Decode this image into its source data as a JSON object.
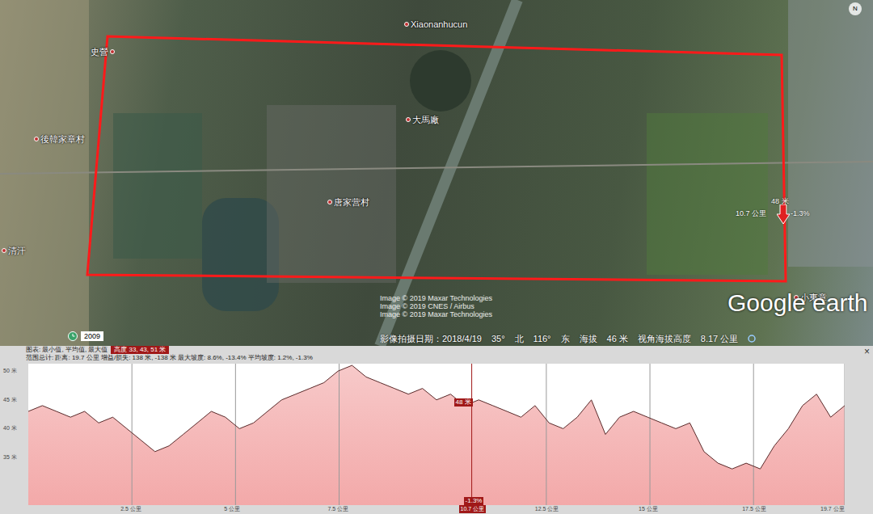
{
  "map": {
    "labels": [
      {
        "text": "史營"
      },
      {
        "text": "Xiaonanhucun"
      },
      {
        "text": "大馬廠"
      },
      {
        "text": "後韓家章村"
      },
      {
        "text": "唐家营村"
      },
      {
        "text": "清汗"
      },
      {
        "text": "小東章"
      }
    ],
    "attribution": [
      "Image © 2019 Maxar Technologies",
      "Image © 2019 CNES / Airbus",
      "Image © 2019 Maxar Technologies"
    ],
    "history_year": "2009",
    "logo": "Google earth",
    "compass": "N",
    "status": {
      "date_label": "影像拍摄日期：",
      "date": "2018/4/19",
      "lat": "35°",
      "lat_dir": "北",
      "lon": "116°",
      "lon_dir": "东",
      "elev_label": "海拔",
      "elev": "46 米",
      "eye_label": "视角海拔高度",
      "eye": "8.17 公里"
    },
    "marker": {
      "elevation": "48 米",
      "distance": "10.7 公里",
      "slope": "-1.3%"
    }
  },
  "profile": {
    "header": {
      "chart_label": "图表: 最小值, 平均值, 最大值",
      "highlight": "高度 33, 43, 51 米",
      "totals": "范围总计: 距离: 19.7 公里 增益/损失: 138 米, -138 米 最大坡度: 8.6%, -13.4% 平均坡度: 1.2%, -1.3%"
    },
    "close": "×",
    "distance_km": 19.7,
    "y_ticks": [
      {
        "label": "35 米",
        "value": 35
      },
      {
        "label": "40 米",
        "value": 40
      },
      {
        "label": "45 米",
        "value": 45
      },
      {
        "label": "50 米",
        "value": 50
      }
    ],
    "x_ticks": [
      {
        "label": "2.5 公里",
        "km": 2.5
      },
      {
        "label": "5 公里",
        "km": 5
      },
      {
        "label": "7.5 公里",
        "km": 7.5
      },
      {
        "label": "12.5 公里",
        "km": 12.5
      },
      {
        "label": "15 公里",
        "km": 15
      },
      {
        "label": "17.5 公里",
        "km": 17.5
      },
      {
        "label": "19.7 公里",
        "km": 19.7
      }
    ],
    "cursor": {
      "km": 10.7,
      "elevation": "48 米",
      "distance": "10.7 公里",
      "slope": "-1.3%"
    },
    "series": {
      "values": [
        43,
        44,
        43,
        42,
        43,
        41,
        42,
        40,
        38,
        36,
        37,
        39,
        41,
        43,
        42,
        40,
        41,
        43,
        45,
        46,
        47,
        48,
        50,
        51,
        49,
        48,
        47,
        46,
        47,
        45,
        46,
        44,
        45,
        44,
        43,
        42,
        44,
        41,
        40,
        42,
        45,
        39,
        42,
        43,
        42,
        41,
        40,
        41,
        36,
        34,
        33,
        34,
        33,
        37,
        40,
        44,
        46,
        42,
        44
      ]
    }
  }
}
